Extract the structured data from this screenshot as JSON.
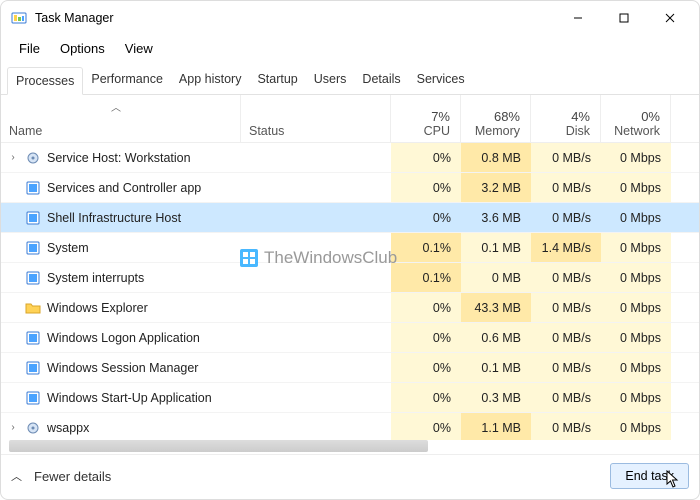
{
  "window": {
    "title": "Task Manager"
  },
  "menu": {
    "file": "File",
    "options": "Options",
    "view": "View"
  },
  "tabs": {
    "processes": "Processes",
    "performance": "Performance",
    "history": "App history",
    "startup": "Startup",
    "users": "Users",
    "details": "Details",
    "services": "Services"
  },
  "columns": {
    "name": "Name",
    "status": "Status",
    "cpu_pct": "7%",
    "cpu_label": "CPU",
    "mem_pct": "68%",
    "mem_label": "Memory",
    "disk_pct": "4%",
    "disk_label": "Disk",
    "net_pct": "0%",
    "net_label": "Network"
  },
  "rows": [
    {
      "name": "Service Host: Workstation",
      "expandable": true,
      "icon": "gear",
      "cpu": "0%",
      "mem": "0.8 MB",
      "disk": "0 MB/s",
      "net": "0 Mbps",
      "heat": "mem"
    },
    {
      "name": "Services and Controller app",
      "expandable": false,
      "icon": "window",
      "cpu": "0%",
      "mem": "3.2 MB",
      "disk": "0 MB/s",
      "net": "0 Mbps",
      "heat": "mem"
    },
    {
      "name": "Shell Infrastructure Host",
      "expandable": false,
      "icon": "window",
      "cpu": "0%",
      "mem": "3.6 MB",
      "disk": "0 MB/s",
      "net": "0 Mbps",
      "selected": true
    },
    {
      "name": "System",
      "expandable": false,
      "icon": "window",
      "cpu": "0.1%",
      "mem": "0.1 MB",
      "disk": "1.4 MB/s",
      "net": "0 Mbps",
      "heat": "cpu,disk"
    },
    {
      "name": "System interrupts",
      "expandable": false,
      "icon": "window",
      "cpu": "0.1%",
      "mem": "0 MB",
      "disk": "0 MB/s",
      "net": "0 Mbps",
      "heat": "cpu"
    },
    {
      "name": "Windows Explorer",
      "expandable": false,
      "icon": "folder",
      "cpu": "0%",
      "mem": "43.3 MB",
      "disk": "0 MB/s",
      "net": "0 Mbps",
      "heat": "mem"
    },
    {
      "name": "Windows Logon Application",
      "expandable": false,
      "icon": "window",
      "cpu": "0%",
      "mem": "0.6 MB",
      "disk": "0 MB/s",
      "net": "0 Mbps"
    },
    {
      "name": "Windows Session Manager",
      "expandable": false,
      "icon": "window",
      "cpu": "0%",
      "mem": "0.1 MB",
      "disk": "0 MB/s",
      "net": "0 Mbps"
    },
    {
      "name": "Windows Start-Up Application",
      "expandable": false,
      "icon": "window",
      "cpu": "0%",
      "mem": "0.3 MB",
      "disk": "0 MB/s",
      "net": "0 Mbps"
    },
    {
      "name": "wsappx",
      "expandable": true,
      "icon": "gear",
      "cpu": "0%",
      "mem": "1.1 MB",
      "disk": "0 MB/s",
      "net": "0 Mbps",
      "heat": "mem"
    }
  ],
  "footer": {
    "details_toggle": "Fewer details",
    "end_task": "End task"
  },
  "watermark": "TheWindowsClub"
}
